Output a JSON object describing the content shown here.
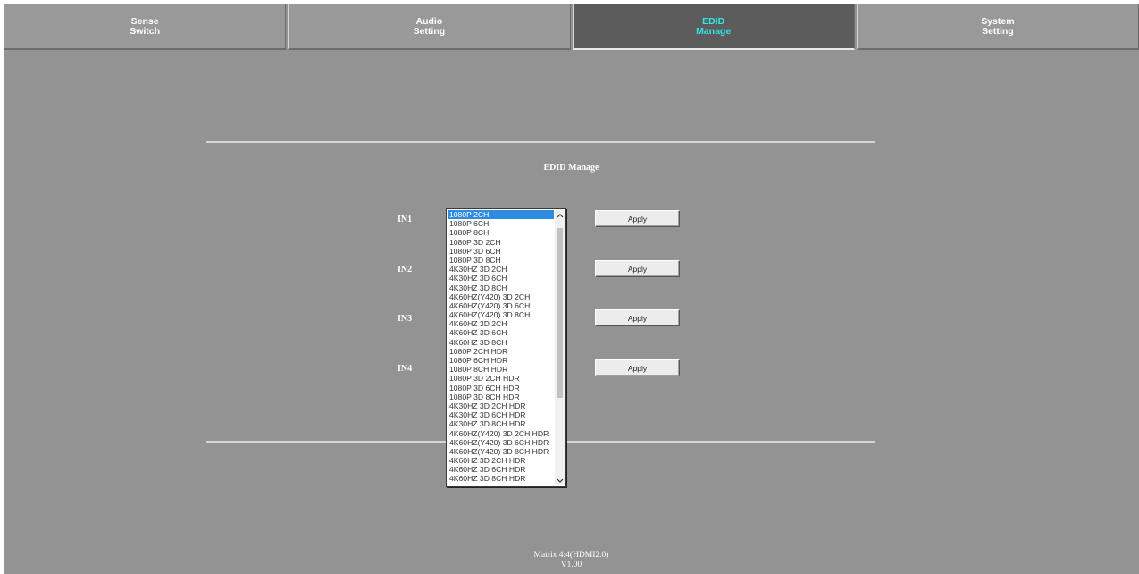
{
  "tabs": [
    {
      "label": "Sense\nSwitch",
      "active": false
    },
    {
      "label": "Audio\nSetting",
      "active": false
    },
    {
      "label": "EDID\nManage",
      "active": true
    },
    {
      "label": "System\nSetting",
      "active": false
    }
  ],
  "panel": {
    "title": "EDID Manage",
    "inputs": [
      {
        "label": "IN1",
        "apply": "Apply"
      },
      {
        "label": "IN2",
        "apply": "Apply"
      },
      {
        "label": "IN3",
        "apply": "Apply"
      },
      {
        "label": "IN4",
        "apply": "Apply"
      }
    ]
  },
  "dropdown": {
    "selected": "1080P 2CH",
    "options": [
      "1080P 2CH",
      "1080P 6CH",
      "1080P 8CH",
      "1080P 3D 2CH",
      "1080P 3D 6CH",
      "1080P 3D 8CH",
      "4K30HZ 3D 2CH",
      "4K30HZ 3D 6CH",
      "4K30HZ 3D 8CH",
      "4K60HZ(Y420) 3D 2CH",
      "4K60HZ(Y420) 3D 6CH",
      "4K60HZ(Y420) 3D 8CH",
      "4K60HZ 3D 2CH",
      "4K60HZ 3D 6CH",
      "4K60HZ 3D 8CH",
      "1080P 2CH HDR",
      "1080P 6CH HDR",
      "1080P 8CH HDR",
      "1080P 3D 2CH HDR",
      "1080P 3D 6CH HDR",
      "1080P 3D 8CH HDR",
      "4K30HZ 3D 2CH HDR",
      "4K30HZ 3D 6CH HDR",
      "4K30HZ 3D 8CH HDR",
      "4K60HZ(Y420) 3D 2CH HDR",
      "4K60HZ(Y420) 3D 6CH HDR",
      "4K60HZ(Y420) 3D 8CH HDR",
      "4K60HZ 3D 2CH HDR",
      "4K60HZ 3D 6CH HDR",
      "4K60HZ 3D 8CH HDR"
    ]
  },
  "footer": {
    "model": "Matrix 4:4(HDMI2.0)",
    "version": "V1.00"
  },
  "icons": {
    "scroll_up": "chevron-up-icon",
    "scroll_down": "chevron-down-icon"
  },
  "colors": {
    "background": "#939393",
    "active_tab": "#5c5c5c",
    "active_tab_text": "#33e6e6",
    "selection": "#2f8be0"
  }
}
